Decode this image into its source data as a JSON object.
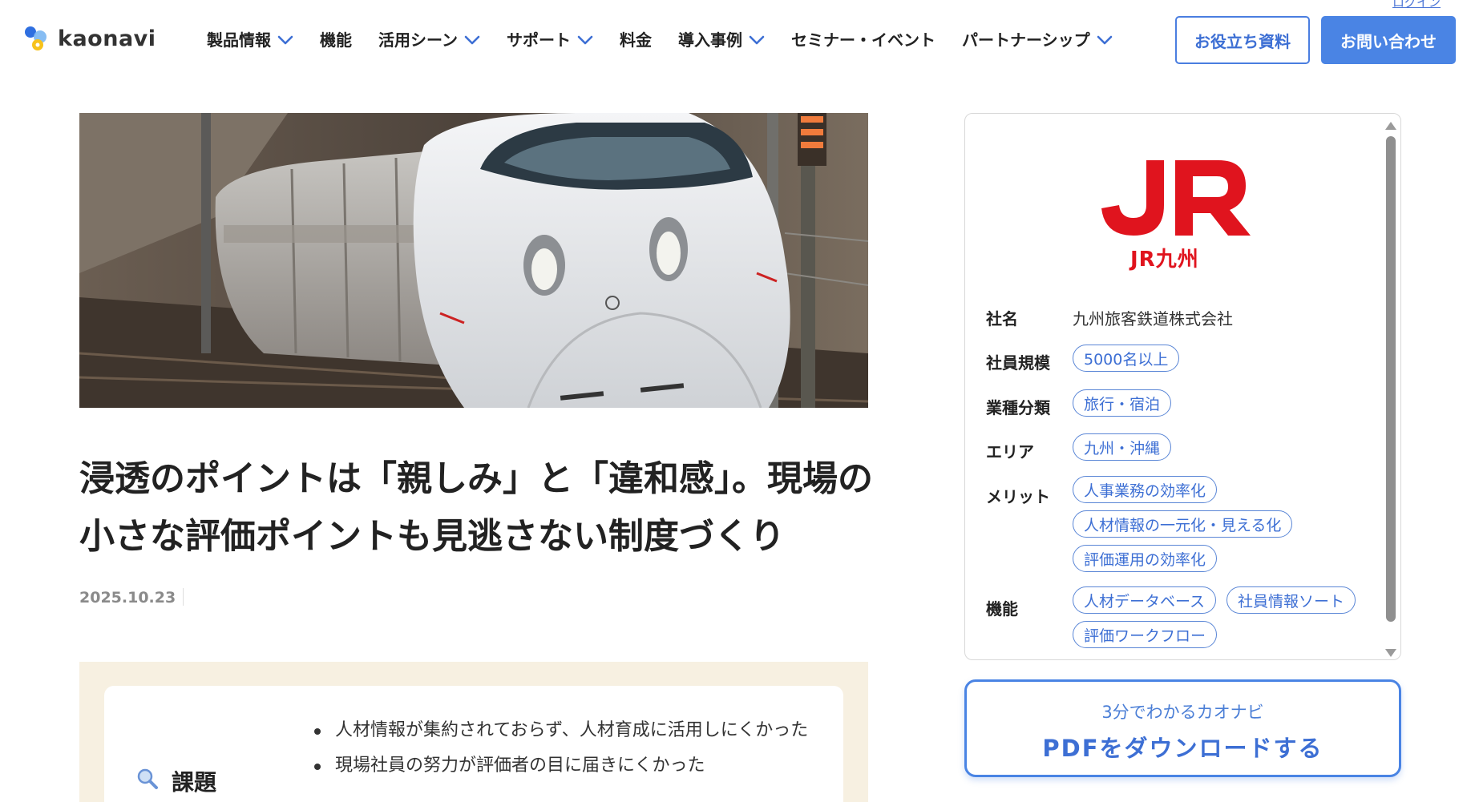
{
  "header": {
    "logo_text": "kaonavi",
    "login": "ログイン",
    "nav": [
      {
        "label": "製品情報",
        "has_dropdown": true
      },
      {
        "label": "機能",
        "has_dropdown": false
      },
      {
        "label": "活用シーン",
        "has_dropdown": true
      },
      {
        "label": "サポート",
        "has_dropdown": true
      },
      {
        "label": "料金",
        "has_dropdown": false
      },
      {
        "label": "導入事例",
        "has_dropdown": true
      },
      {
        "label": "セミナー・イベント",
        "has_dropdown": false
      },
      {
        "label": "パートナーシップ",
        "has_dropdown": true
      }
    ],
    "resources_button": "お役立ち資料",
    "contact_button": "お問い合わせ"
  },
  "article": {
    "title": "浸透のポイントは「親しみ」と「違和感」。現場の小さな評価ポイントも見逃さない制度づくり",
    "date": "2025.10.23",
    "issue_label": "課題",
    "issues": [
      "人材情報が集約されておらず、人材育成に活用しにくかった",
      "現場社員の努力が評価者の目に届きにくかった"
    ]
  },
  "company": {
    "logo_caption": "JR九州",
    "rows": {
      "name_label": "社名",
      "name_value": "九州旅客鉄道株式会社",
      "size_label": "社員規模",
      "size_tags": [
        "5000名以上"
      ],
      "industry_label": "業種分類",
      "industry_tags": [
        "旅行・宿泊"
      ],
      "area_label": "エリア",
      "area_tags": [
        "九州・沖縄"
      ],
      "merit_label": "メリット",
      "merit_tags": [
        "人事業務の効率化",
        "人材情報の一元化・見える化",
        "評価運用の効率化"
      ],
      "feature_label": "機能",
      "feature_tags": [
        "人材データベース",
        "社員情報ソート",
        "評価ワークフロー"
      ]
    }
  },
  "pdf_cta": {
    "sub": "3分でわかるカオナビ",
    "main": "PDFをダウンロードする"
  },
  "colors": {
    "accent": "#4a84e4",
    "jr_red": "#e0141e",
    "summary_bg": "#f7f0e1"
  }
}
